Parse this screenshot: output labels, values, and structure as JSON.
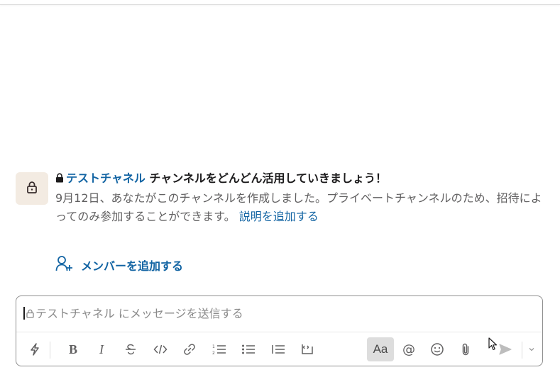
{
  "intro": {
    "channel_name": "テストチャネル",
    "title_suffix": " チャンネルをどんどん活用していきましょう！",
    "description": "9月12日、あなたがこのチャンネルを作成しました。プライベートチャンネルのため、招待によってのみ参加することができます。",
    "add_description_link": "説明を追加する",
    "icon": "lock-icon"
  },
  "add_members": {
    "label": "メンバーを追加する",
    "icon": "add-user-icon"
  },
  "composer": {
    "placeholder": "テストチャネル にメッセージを送信する",
    "value": ""
  },
  "toolbar": {
    "shortcuts": {
      "icon": "lightning-icon"
    },
    "bold": {
      "label": "B",
      "icon": "bold-icon"
    },
    "italic": {
      "label": "I",
      "icon": "italic-icon"
    },
    "strikethrough": {
      "icon": "strikethrough-icon"
    },
    "code": {
      "icon": "code-icon"
    },
    "link": {
      "icon": "link-icon"
    },
    "ordered_list": {
      "icon": "ordered-list-icon"
    },
    "bulleted_list": {
      "icon": "bulleted-list-icon"
    },
    "blockquote": {
      "icon": "blockquote-icon"
    },
    "code_block": {
      "icon": "code-block-icon"
    },
    "formatting": {
      "label": "Aa",
      "active": true
    },
    "mention": {
      "label": "@",
      "icon": "mention-icon"
    },
    "emoji": {
      "icon": "emoji-icon"
    },
    "attach": {
      "icon": "paperclip-icon"
    },
    "send": {
      "icon": "send-icon"
    },
    "send_options": {
      "icon": "chevron-down-icon"
    }
  },
  "colors": {
    "link": "#1264a3",
    "avatar_bg": "#f3ebe2",
    "muted_text": "#616061",
    "active_button_bg": "#dddddd"
  }
}
